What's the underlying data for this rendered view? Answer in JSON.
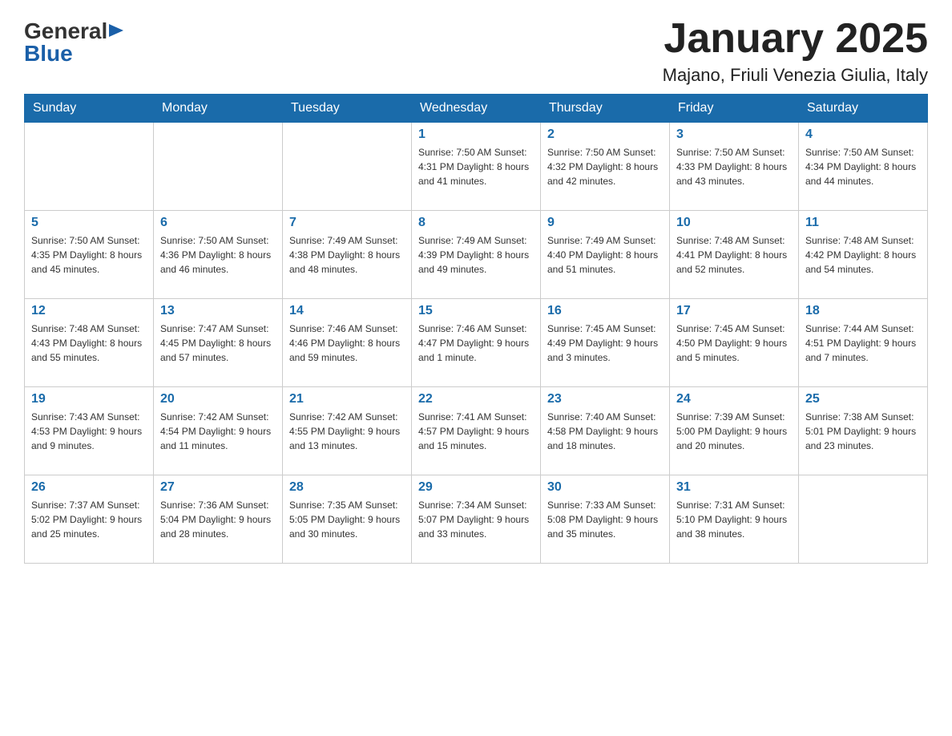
{
  "header": {
    "logo": {
      "general": "General",
      "blue": "Blue",
      "triangle": "▶"
    },
    "title": "January 2025",
    "location": "Majano, Friuli Venezia Giulia, Italy"
  },
  "calendar": {
    "days_of_week": [
      "Sunday",
      "Monday",
      "Tuesday",
      "Wednesday",
      "Thursday",
      "Friday",
      "Saturday"
    ],
    "weeks": [
      [
        {
          "day": "",
          "info": ""
        },
        {
          "day": "",
          "info": ""
        },
        {
          "day": "",
          "info": ""
        },
        {
          "day": "1",
          "info": "Sunrise: 7:50 AM\nSunset: 4:31 PM\nDaylight: 8 hours\nand 41 minutes."
        },
        {
          "day": "2",
          "info": "Sunrise: 7:50 AM\nSunset: 4:32 PM\nDaylight: 8 hours\nand 42 minutes."
        },
        {
          "day": "3",
          "info": "Sunrise: 7:50 AM\nSunset: 4:33 PM\nDaylight: 8 hours\nand 43 minutes."
        },
        {
          "day": "4",
          "info": "Sunrise: 7:50 AM\nSunset: 4:34 PM\nDaylight: 8 hours\nand 44 minutes."
        }
      ],
      [
        {
          "day": "5",
          "info": "Sunrise: 7:50 AM\nSunset: 4:35 PM\nDaylight: 8 hours\nand 45 minutes."
        },
        {
          "day": "6",
          "info": "Sunrise: 7:50 AM\nSunset: 4:36 PM\nDaylight: 8 hours\nand 46 minutes."
        },
        {
          "day": "7",
          "info": "Sunrise: 7:49 AM\nSunset: 4:38 PM\nDaylight: 8 hours\nand 48 minutes."
        },
        {
          "day": "8",
          "info": "Sunrise: 7:49 AM\nSunset: 4:39 PM\nDaylight: 8 hours\nand 49 minutes."
        },
        {
          "day": "9",
          "info": "Sunrise: 7:49 AM\nSunset: 4:40 PM\nDaylight: 8 hours\nand 51 minutes."
        },
        {
          "day": "10",
          "info": "Sunrise: 7:48 AM\nSunset: 4:41 PM\nDaylight: 8 hours\nand 52 minutes."
        },
        {
          "day": "11",
          "info": "Sunrise: 7:48 AM\nSunset: 4:42 PM\nDaylight: 8 hours\nand 54 minutes."
        }
      ],
      [
        {
          "day": "12",
          "info": "Sunrise: 7:48 AM\nSunset: 4:43 PM\nDaylight: 8 hours\nand 55 minutes."
        },
        {
          "day": "13",
          "info": "Sunrise: 7:47 AM\nSunset: 4:45 PM\nDaylight: 8 hours\nand 57 minutes."
        },
        {
          "day": "14",
          "info": "Sunrise: 7:46 AM\nSunset: 4:46 PM\nDaylight: 8 hours\nand 59 minutes."
        },
        {
          "day": "15",
          "info": "Sunrise: 7:46 AM\nSunset: 4:47 PM\nDaylight: 9 hours\nand 1 minute."
        },
        {
          "day": "16",
          "info": "Sunrise: 7:45 AM\nSunset: 4:49 PM\nDaylight: 9 hours\nand 3 minutes."
        },
        {
          "day": "17",
          "info": "Sunrise: 7:45 AM\nSunset: 4:50 PM\nDaylight: 9 hours\nand 5 minutes."
        },
        {
          "day": "18",
          "info": "Sunrise: 7:44 AM\nSunset: 4:51 PM\nDaylight: 9 hours\nand 7 minutes."
        }
      ],
      [
        {
          "day": "19",
          "info": "Sunrise: 7:43 AM\nSunset: 4:53 PM\nDaylight: 9 hours\nand 9 minutes."
        },
        {
          "day": "20",
          "info": "Sunrise: 7:42 AM\nSunset: 4:54 PM\nDaylight: 9 hours\nand 11 minutes."
        },
        {
          "day": "21",
          "info": "Sunrise: 7:42 AM\nSunset: 4:55 PM\nDaylight: 9 hours\nand 13 minutes."
        },
        {
          "day": "22",
          "info": "Sunrise: 7:41 AM\nSunset: 4:57 PM\nDaylight: 9 hours\nand 15 minutes."
        },
        {
          "day": "23",
          "info": "Sunrise: 7:40 AM\nSunset: 4:58 PM\nDaylight: 9 hours\nand 18 minutes."
        },
        {
          "day": "24",
          "info": "Sunrise: 7:39 AM\nSunset: 5:00 PM\nDaylight: 9 hours\nand 20 minutes."
        },
        {
          "day": "25",
          "info": "Sunrise: 7:38 AM\nSunset: 5:01 PM\nDaylight: 9 hours\nand 23 minutes."
        }
      ],
      [
        {
          "day": "26",
          "info": "Sunrise: 7:37 AM\nSunset: 5:02 PM\nDaylight: 9 hours\nand 25 minutes."
        },
        {
          "day": "27",
          "info": "Sunrise: 7:36 AM\nSunset: 5:04 PM\nDaylight: 9 hours\nand 28 minutes."
        },
        {
          "day": "28",
          "info": "Sunrise: 7:35 AM\nSunset: 5:05 PM\nDaylight: 9 hours\nand 30 minutes."
        },
        {
          "day": "29",
          "info": "Sunrise: 7:34 AM\nSunset: 5:07 PM\nDaylight: 9 hours\nand 33 minutes."
        },
        {
          "day": "30",
          "info": "Sunrise: 7:33 AM\nSunset: 5:08 PM\nDaylight: 9 hours\nand 35 minutes."
        },
        {
          "day": "31",
          "info": "Sunrise: 7:31 AM\nSunset: 5:10 PM\nDaylight: 9 hours\nand 38 minutes."
        },
        {
          "day": "",
          "info": ""
        }
      ]
    ]
  }
}
